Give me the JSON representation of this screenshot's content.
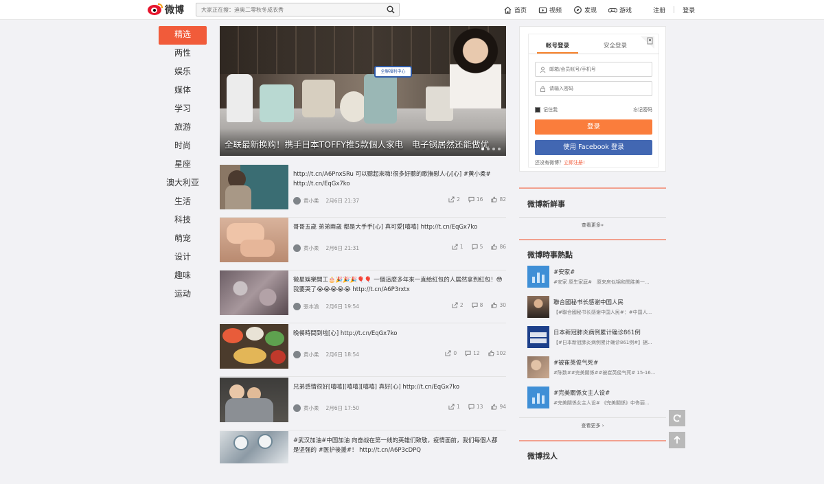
{
  "header": {
    "logo_text": "微博",
    "search_placeholder": "大家正在搜：迪奥二零秋冬成衣秀",
    "nav": [
      {
        "label": "首页",
        "icon": "home-icon"
      },
      {
        "label": "视频",
        "icon": "video-icon"
      },
      {
        "label": "发现",
        "icon": "discover-icon"
      },
      {
        "label": "游戏",
        "icon": "game-icon"
      }
    ],
    "register": "注册",
    "login": "登录"
  },
  "categories": [
    "精选",
    "两性",
    "娱乐",
    "媒体",
    "学习",
    "旅游",
    "时尚",
    "星座",
    "澳大利亚",
    "生活",
    "科技",
    "萌宠",
    "设计",
    "趣味",
    "运动"
  ],
  "hero": {
    "caption": "全联最新换购！携手日本TOFFY推5款個人家电　电子锅居然还能做优",
    "sign_text": "全聯福利中心"
  },
  "posts": [
    {
      "text": "http://t.cn/A6PnxSRu 可以聽起來嗨!很多好聽的歌撫慰人心[心] #黄小柔# http://t.cn/EqGx7ko",
      "author": "黄小柔",
      "time": "2月6日 21:37",
      "share": "2",
      "comment": "16",
      "like": "82"
    },
    {
      "text": "哥哥五歲 弟弟兩歲 都是大手手[心] 真可愛[嘻嘻] http://t.cn/EqGx7ko",
      "author": "黄小柔",
      "time": "2月6日 21:31",
      "share": "1",
      "comment": "5",
      "like": "86"
    },
    {
      "text": "徵星娛樂開工🎂🎉🎉🎉🎈🎈 一個這麼多年來一直給紅包的人居然拿到紅包！😳 我要哭了😭😭😭😭😭 http://t.cn/A6P3rxtx",
      "author": "張本渝",
      "time": "2月6日 19:54",
      "share": "2",
      "comment": "8",
      "like": "30"
    },
    {
      "text": "晚餐時間到啦[心] http://t.cn/EqGx7ko",
      "author": "黄小柔",
      "time": "2月6日 18:54",
      "share": "0",
      "comment": "12",
      "like": "102"
    },
    {
      "text": "兄弟感情很好[嘻嘻][嘻嘻][嘻嘻] 真好[心] http://t.cn/EqGx7ko",
      "author": "黄小柔",
      "time": "2月6日 17:50",
      "share": "1",
      "comment": "13",
      "like": "94"
    },
    {
      "text": "#武汉加油#中国加油 向奋战在第一线的英雄们致敬，疫情面前，我们每個人都是坚强的 #医护後援#！ http://t.cn/A6P3cDPQ",
      "author": "",
      "time": "",
      "share": "",
      "comment": "",
      "like": ""
    }
  ],
  "login": {
    "tab_account": "帐号登录",
    "tab_secure": "安全登录",
    "username_placeholder": "邮箱/会员帐号/手机号",
    "password_placeholder": "请输入密码",
    "remember": "记住我",
    "forgot": "忘记密码",
    "login_button": "登录",
    "facebook_button": "使用 Facebook 登录",
    "no_account": "还没有微博？",
    "register_now": "立即注册!"
  },
  "panels": {
    "fresh": {
      "title": "微博新鲜事",
      "more": "查看更多»"
    },
    "hot": {
      "title": "微博時事熱點",
      "more": "查看更多 ›",
      "items": [
        {
          "title": "#安家#",
          "desc": "#安家 原生家庭#　原来房似锦和閔胜美一..."
        },
        {
          "title": "聯合國秘书长感谢中国人民",
          "desc": "【#聯合國秘书长感谢中国人民#：#中国人..."
        },
        {
          "title": "日本新冠肺炎病例累计确诊861例",
          "desc": "【#日本新冠肺炎病例累计确诊861例#】据..."
        },
        {
          "title": "#被崔英俊气死#",
          "desc": "#陈数##完美關係##被崔英俊气死# 15-16..."
        },
        {
          "title": "#完美關係女主人设#",
          "desc": "#完美關係女主人设# 《完美關係》中佟丽..."
        }
      ]
    },
    "people": {
      "title": "微博找人"
    }
  },
  "colors": {
    "accent": "#f15b3a",
    "login_orange": "#fa7d3c",
    "facebook_blue": "#4267b2"
  }
}
